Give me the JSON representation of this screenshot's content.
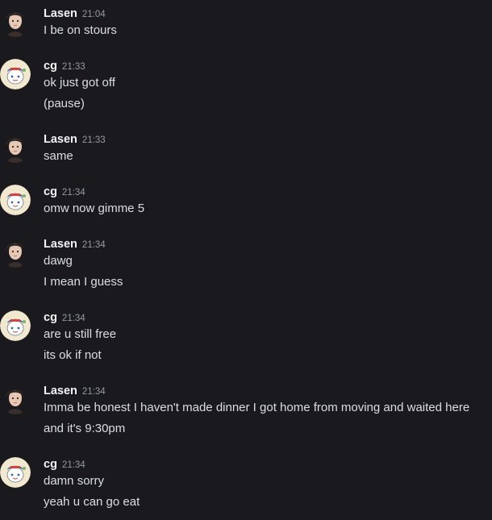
{
  "channel": {
    "messages": [
      {
        "user": "Lasen",
        "time": "21:04",
        "avatar_icon": "lasen-avatar-icon",
        "lines": [
          "I be on stours"
        ]
      },
      {
        "user": "cg",
        "time": "21:33",
        "avatar_icon": "cg-avatar-icon",
        "lines": [
          "ok just got off",
          "(pause)"
        ]
      },
      {
        "user": "Lasen",
        "time": "21:33",
        "avatar_icon": "lasen-avatar-icon",
        "lines": [
          "same"
        ]
      },
      {
        "user": "cg",
        "time": "21:34",
        "avatar_icon": "cg-avatar-icon",
        "lines": [
          "omw now gimme 5"
        ]
      },
      {
        "user": "Lasen",
        "time": "21:34",
        "avatar_icon": "lasen-avatar-icon",
        "lines": [
          "dawg",
          "I mean I guess"
        ]
      },
      {
        "user": "cg",
        "time": "21:34",
        "avatar_icon": "cg-avatar-icon",
        "lines": [
          "are u still free",
          "its ok if not"
        ]
      },
      {
        "user": "Lasen",
        "time": "21:34",
        "avatar_icon": "lasen-avatar-icon",
        "lines": [
          "Imma be honest I haven't made dinner I got home from moving and waited here",
          "and it's 9:30pm"
        ]
      },
      {
        "user": "cg",
        "time": "21:34",
        "avatar_icon": "cg-avatar-icon",
        "lines": [
          "damn sorry",
          "yeah u can go eat"
        ]
      }
    ]
  },
  "colors": {
    "background": "#1a1a1e",
    "username": "#f2f3f5",
    "timestamp": "#949ba4",
    "message_text": "#dbdee1"
  }
}
